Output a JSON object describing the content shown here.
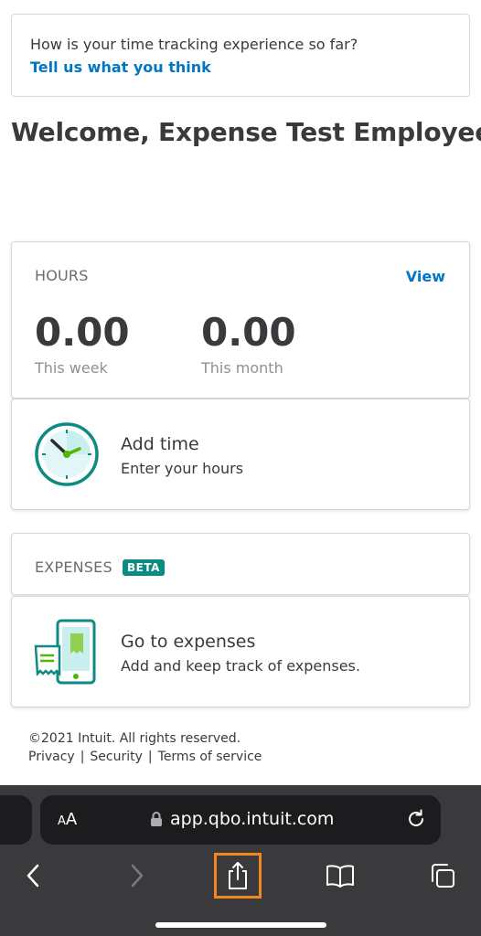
{
  "feedback": {
    "question": "How is your time tracking experience so far?",
    "link": "Tell us what you think"
  },
  "welcome": "Welcome, Expense Test Employee",
  "hours": {
    "label": "HOURS",
    "view_link": "View",
    "week_value": "0.00",
    "week_caption": "This week",
    "month_value": "0.00",
    "month_caption": "This month"
  },
  "add_time": {
    "title": "Add time",
    "subtitle": "Enter your hours"
  },
  "expenses": {
    "label": "EXPENSES",
    "badge": "BETA",
    "title": "Go to expenses",
    "subtitle": "Add and keep track of expenses."
  },
  "footer": {
    "copyright": "©2021 Intuit. All rights reserved.",
    "links": [
      "Privacy",
      "Security",
      "Terms of service"
    ],
    "separator": "|"
  },
  "browser": {
    "aa_large": "A",
    "aa_small": "A",
    "url": "app.qbo.intuit.com"
  },
  "colors": {
    "link": "#0077c5",
    "beta_badge": "#0d8a82",
    "highlight": "#f0871f"
  }
}
